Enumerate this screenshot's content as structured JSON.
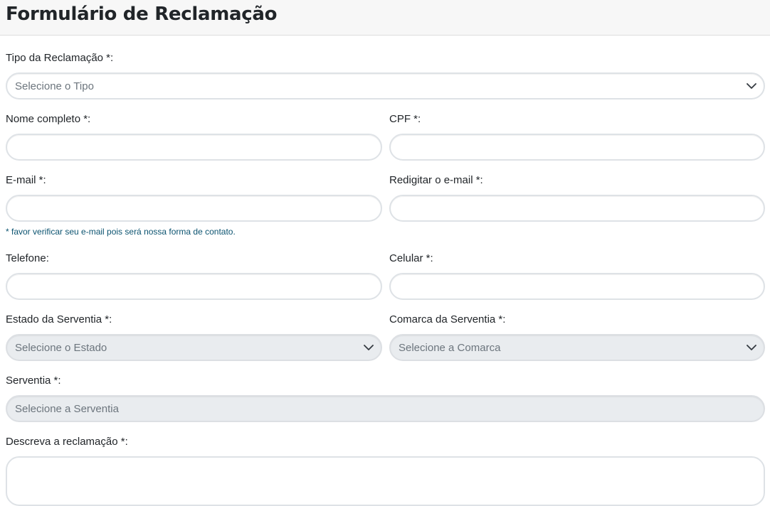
{
  "page": {
    "title": "Formulário de Reclamação"
  },
  "form": {
    "tipo": {
      "label": "Tipo da Reclamação *:",
      "placeholder": "Selecione o Tipo"
    },
    "nome": {
      "label": "Nome completo *:",
      "value": ""
    },
    "cpf": {
      "label": "CPF *:",
      "value": ""
    },
    "email": {
      "label": "E-mail *:",
      "value": ""
    },
    "email_confirm": {
      "label": "Redigitar o e-mail *:",
      "value": ""
    },
    "email_hint": "* favor verificar seu e-mail pois será nossa forma de contato.",
    "telefone": {
      "label": "Telefone:",
      "value": ""
    },
    "celular": {
      "label": "Celular *:",
      "value": ""
    },
    "estado": {
      "label": "Estado da Serventia *:",
      "placeholder": "Selecione o Estado"
    },
    "comarca": {
      "label": "Comarca da Serventia *:",
      "placeholder": "Selecione a Comarca"
    },
    "serventia": {
      "label": "Serventia *:",
      "placeholder": "Selecione a Serventia"
    },
    "descricao": {
      "label": "Descreva a reclamação *:",
      "value": ""
    }
  },
  "icons": {
    "select_arrow": "chevron-down-icon"
  },
  "colors": {
    "hint": "#0b5370",
    "disabled_bg": "#e9ecef",
    "border": "#dee2e6"
  }
}
